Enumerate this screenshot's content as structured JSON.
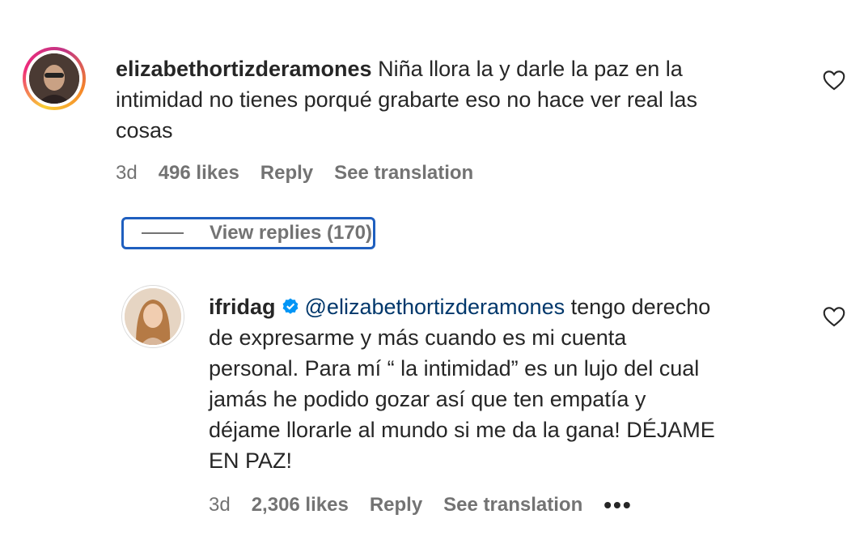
{
  "comment1": {
    "username": "elizabethortizderamones",
    "text_line1": "Niña llora la y darle la paz en la",
    "text_line2": "intimidad no tienes porqué grabarte eso no hace ver real las",
    "text_line3": "cosas",
    "time": "3d",
    "likes": "496 likes",
    "reply": "Reply",
    "see_translation": "See translation",
    "view_replies": "View replies (170)"
  },
  "comment2": {
    "username": "ifridag",
    "mention": "@elizabethortizderamones",
    "text_line1_rest": " tengo derecho",
    "text_line2": "de expresarme y más cuando es mi cuenta",
    "text_line3": "personal. Para mí “ la intimidad” es un lujo del cual",
    "text_line4": "jamás he podido gozar así que ten empatía y",
    "text_line5": "déjame llorarle al mundo si me da la gana! DÉJAME",
    "text_line6": "EN PAZ!",
    "time": "3d",
    "likes": "2,306 likes",
    "reply": "Reply",
    "see_translation": "See translation",
    "more": "•••"
  },
  "icons": {
    "heart": "heart-outline-icon",
    "verified": "verified-badge-icon",
    "verified_color": "#0095f6"
  }
}
